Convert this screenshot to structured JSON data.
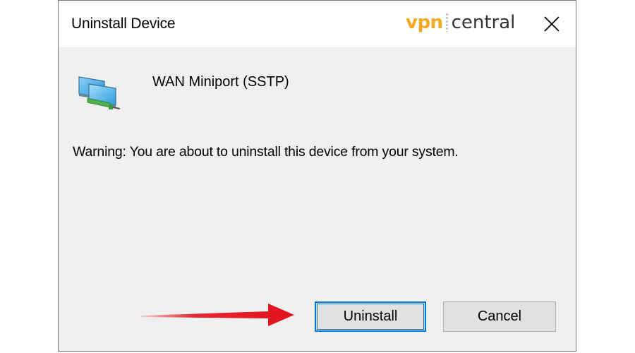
{
  "dialog": {
    "title": "Uninstall Device",
    "close_icon": "close-icon",
    "device": {
      "icon": "network-adapter-icon",
      "name": "WAN Miniport (SSTP)"
    },
    "warning": "Warning: You are about to uninstall this device from your system.",
    "buttons": {
      "uninstall": "Uninstall",
      "cancel": "Cancel"
    }
  },
  "watermark": {
    "vpn": "vpn",
    "central": "central",
    "vpn_color": "#f7a823",
    "central_color": "#333333"
  },
  "annotation": {
    "arrow_icon": "red-arrow-icon",
    "arrow_color": "#e3111b"
  },
  "colors": {
    "dialog_bg": "#f0f0f0",
    "titlebar_bg": "#ffffff",
    "button_bg": "#e1e1e1",
    "focus_border": "#0078d7"
  }
}
